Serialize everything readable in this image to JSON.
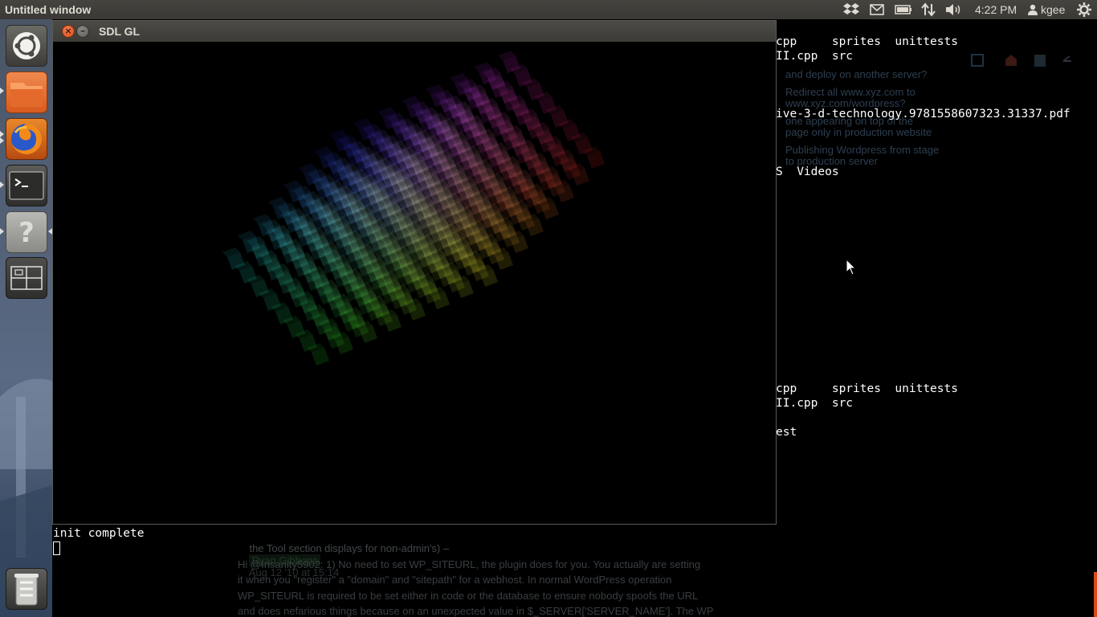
{
  "top_panel": {
    "window_title": "Untitled window",
    "clock": "4:22 PM",
    "user": "kgee",
    "tray_icons": [
      "dropbox-icon",
      "mail-icon",
      "battery-icon",
      "network-icon",
      "volume-icon",
      "user-icon",
      "power-gear-icon"
    ]
  },
  "launcher": {
    "items": [
      "ubuntu-dash-icon",
      "files-icon",
      "firefox-icon",
      "terminal-icon",
      "help-icon",
      "workspace-switcher-icon",
      "trash-icon"
    ]
  },
  "sdl_window": {
    "title": "SDL GL"
  },
  "front_terminal": {
    "line1": "init complete"
  },
  "bg_terminal": {
    "lines": [
      "cpp     sprites  unittests",
      "II.cpp  src",
      "ive-3-d-technology.9781558607323.31337.pdf",
      "S  Videos",
      "cpp     sprites  unittests",
      "II.cpp  src",
      "est"
    ]
  },
  "ghost_page": {
    "sidebar_links": [
      "and deploy on another server?",
      "Redirect all www.xyz.com to",
      "www.xyz.com/wordpress?",
      "one appearing on top of the",
      "page only in production website",
      "Publishing Wordpress from stage",
      "to production server"
    ],
    "comment_tail": "the Tool section displays for non-admin's) –",
    "comment_author": "Ryan Gibbons",
    "comment_date": "Aug 12 '10 at 15:14",
    "answer_lines": [
      "Hi @Insanity5902: 1) No need to set WP_SITEURL, the plugin does for you. You actually are setting",
      "it when you \"register\" a \"domain\" and \"sitepath\" for a webhost. In normal WordPress operation",
      "WP_SITEURL is required to be set either in code or the database to ensure nobody spoofs the URL",
      "and does nefarious things because on an unexpected value in $_SERVER['SERVER_NAME']. The WP"
    ]
  },
  "colors": {
    "panel_bg": "#3c3b37",
    "close_button": "#e05f2a",
    "accent_orange": "#e0481c"
  }
}
